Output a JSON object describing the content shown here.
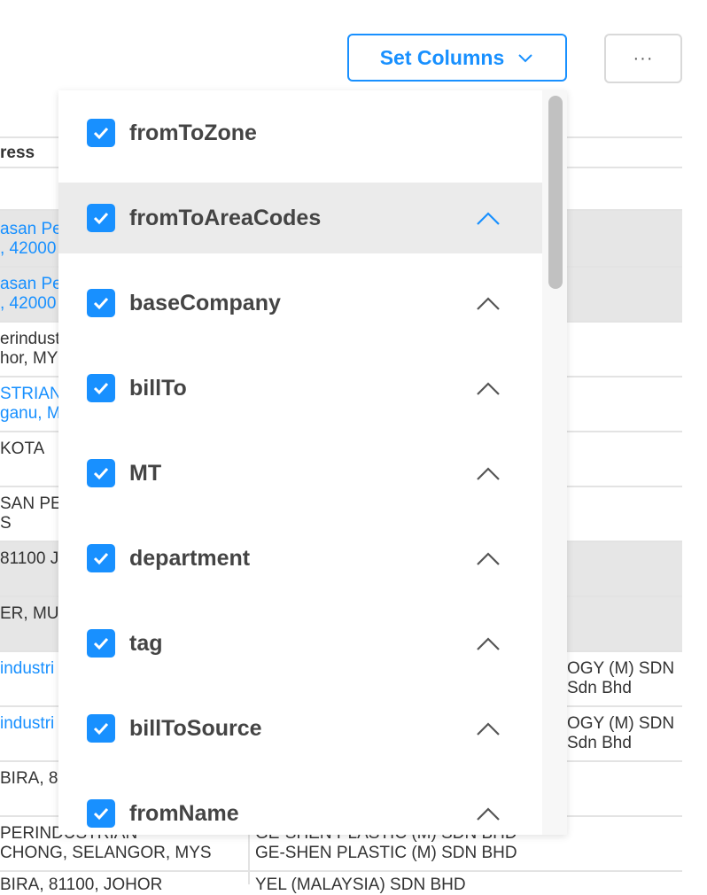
{
  "toolbar": {
    "set_columns_label": "Set Columns",
    "more_label": "···"
  },
  "table": {
    "header_label": "ress",
    "left_cells": [
      {
        "l1": "asan Pe",
        "l2": ", 42000",
        "blue": true
      },
      {
        "l1": "asan Pe",
        "l2": ", 42000",
        "blue": true
      },
      {
        "l1": "erindust",
        "l2": "hor, MY",
        "blue": false
      },
      {
        "l1": "STRIAN",
        "l2": "ganu, M",
        "blue": true
      },
      {
        "l1": " KOTA",
        "l2": "",
        "blue": false
      },
      {
        "l1": "SAN PE",
        "l2": "S",
        "blue": false
      },
      {
        "l1": "81100 J",
        "l2": "",
        "blue": false
      },
      {
        "l1": "ER, MUI",
        "l2": "",
        "blue": false
      },
      {
        "l1": "industri",
        "l2": "",
        "blue": true
      },
      {
        "l1": "industri",
        "l2": "",
        "blue": true
      },
      {
        "l1": "BIRA, 8",
        "l2": "",
        "blue": false
      }
    ],
    "right_cells": [
      {
        "l1": "OGY (M) SDN",
        "l2": "Sdn Bhd"
      },
      {
        "l1": "OGY (M) SDN",
        "l2": "Sdn Bhd"
      }
    ],
    "bottom_rows": [
      {
        "left1": "PERINDUSTRIAN",
        "left2": "CHONG, SELANGOR, MYS",
        "right1": "GE-SHEN PLASTIC (M) SDN BHD",
        "right2": "GE-SHEN PLASTIC (M) SDN BHD"
      },
      {
        "left1": "BIRA, 81100, JOHOR",
        "left2": "",
        "right1": "YEL (MALAYSIA) SDN BHD",
        "right2": ""
      }
    ]
  },
  "column_options": [
    {
      "label": "fromToZone",
      "checked": true,
      "chevron": false
    },
    {
      "label": "fromToAreaCodes",
      "checked": true,
      "chevron": true,
      "active": true
    },
    {
      "label": "baseCompany",
      "checked": true,
      "chevron": true
    },
    {
      "label": "billTo",
      "checked": true,
      "chevron": true
    },
    {
      "label": "MT",
      "checked": true,
      "chevron": true
    },
    {
      "label": "department",
      "checked": true,
      "chevron": true
    },
    {
      "label": "tag",
      "checked": true,
      "chevron": true
    },
    {
      "label": "billToSource",
      "checked": true,
      "chevron": true
    },
    {
      "label": "fromName",
      "checked": true,
      "chevron": true
    }
  ],
  "colors": {
    "accent": "#1890ff",
    "hover_row": "#ebebeb",
    "shaded_row": "#e6e6e6"
  }
}
